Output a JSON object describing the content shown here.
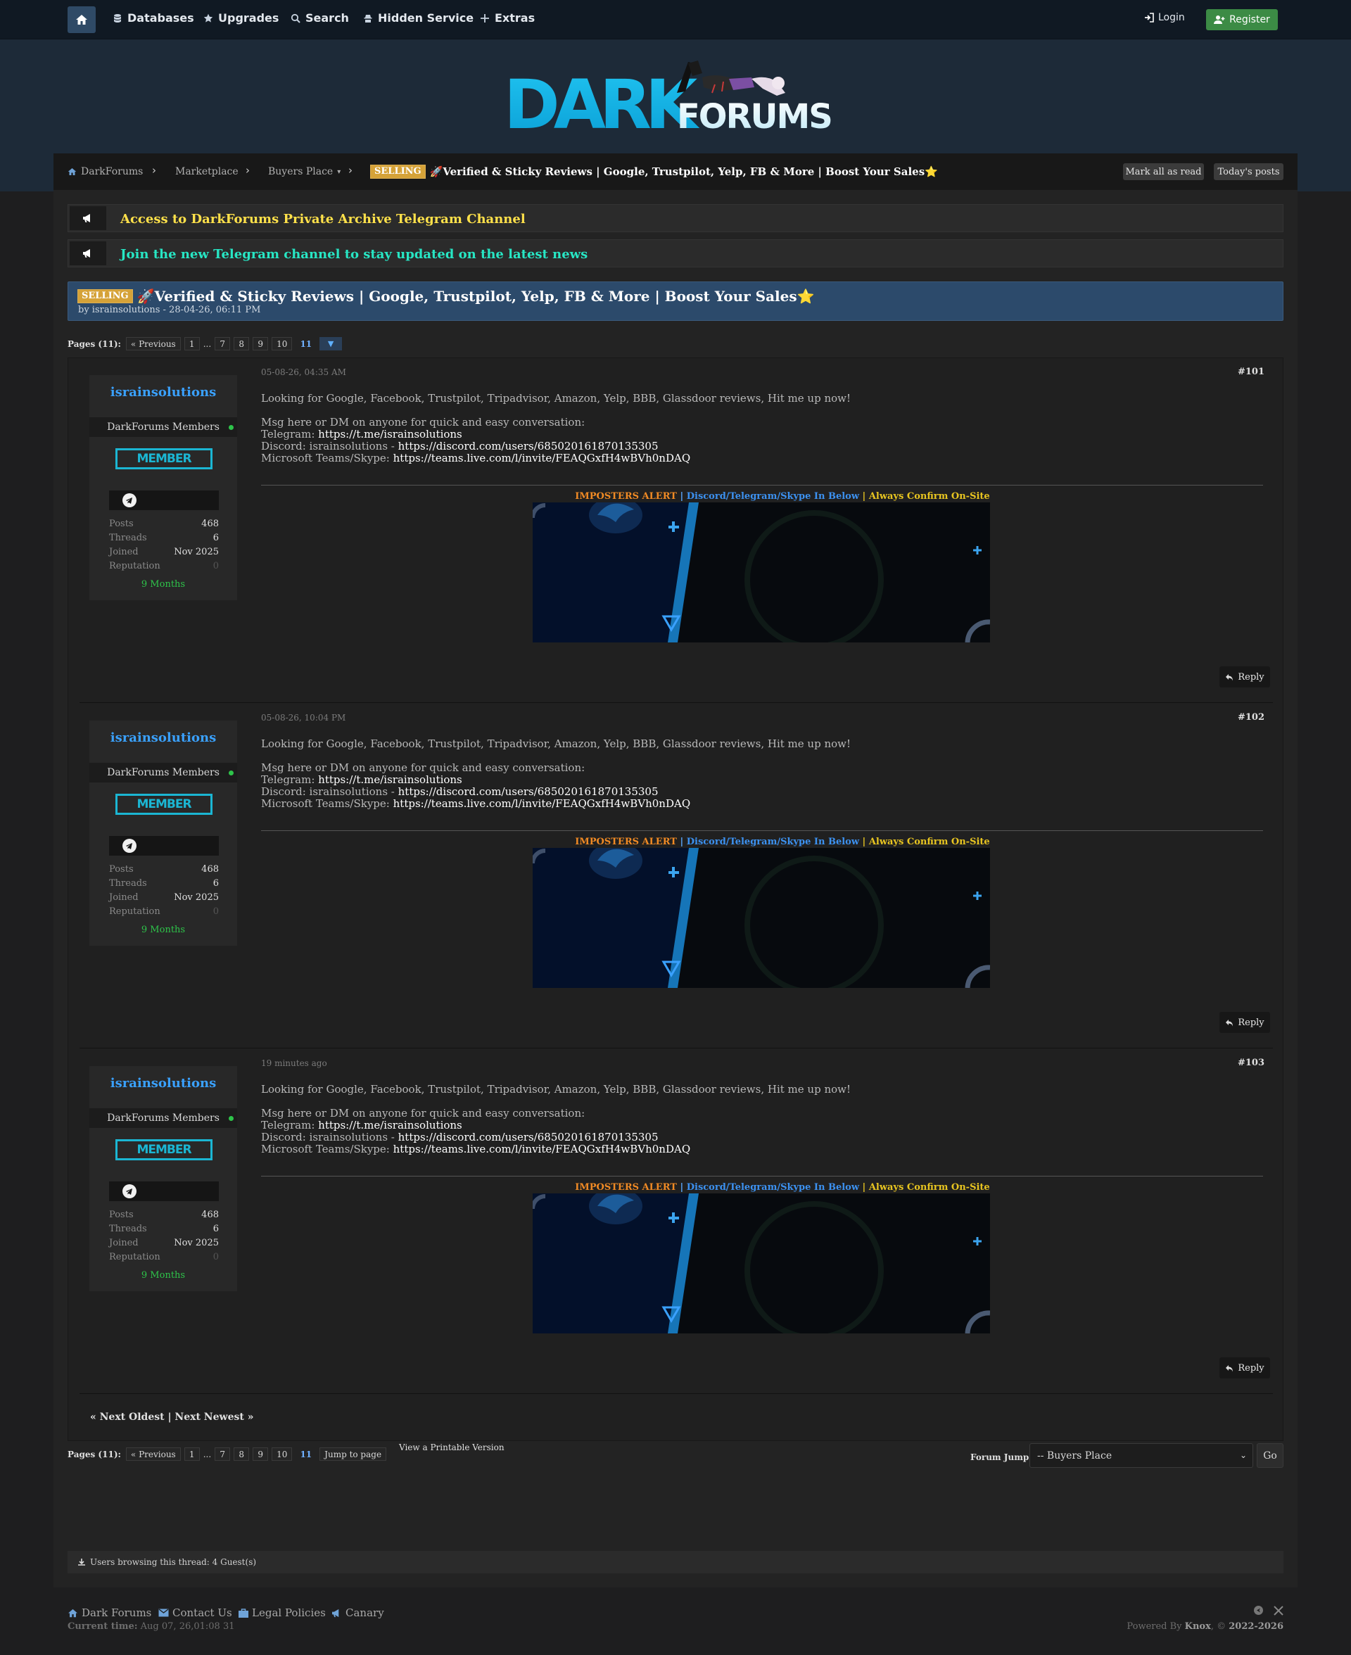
{
  "nav": {
    "items": [
      "Databases",
      "Upgrades",
      "Search",
      "Hidden Service",
      "Extras"
    ],
    "login": "Login",
    "register": "Register"
  },
  "logo": {
    "dark": "DARK",
    "forums": "FORUMS"
  },
  "breadcrumb": {
    "items": [
      "DarkForums",
      "Marketplace",
      "Buyers Place"
    ],
    "prefix": "SELLING",
    "current": "🚀Verified & Sticky Reviews | Google, Trustpilot, Yelp, FB & More | Boost Your Sales⭐"
  },
  "toolbar": {
    "mark_read": "Mark all as read",
    "todays_posts": "Today's posts"
  },
  "announcements": [
    {
      "text": "Access to DarkForums Private Archive Telegram Channel",
      "color": "#ffe14a"
    },
    {
      "text": "Join the new Telegram channel to stay updated on the latest news",
      "color": "#27e6c4"
    }
  ],
  "thread": {
    "prefix": "SELLING",
    "title": "🚀Verified & Sticky Reviews | Google, Trustpilot, Yelp, FB & More | Boost Your Sales⭐",
    "byline": "by israinsolutions - 28-04-26, 06:11 PM"
  },
  "pagination": {
    "label": "Pages (11):",
    "prev": "« Previous",
    "pages": [
      "1",
      "...",
      "7",
      "8",
      "9",
      "10",
      "11"
    ],
    "current": "11",
    "jump": "Jump to page"
  },
  "posts": [
    {
      "author": "israinsolutions",
      "group": "DarkForums Members",
      "rank": "MEMBER",
      "posts": "468",
      "threads": "6",
      "joined": "Nov 2025",
      "reputation": "0",
      "tenure": "9 Months",
      "date": "05-08-26, 04:35 AM",
      "number": "#101"
    },
    {
      "author": "israinsolutions",
      "group": "DarkForums Members",
      "rank": "MEMBER",
      "posts": "468",
      "threads": "6",
      "joined": "Nov 2025",
      "reputation": "0",
      "tenure": "9 Months",
      "date": "05-08-26, 10:04 PM",
      "number": "#102"
    },
    {
      "author": "israinsolutions",
      "group": "DarkForums Members",
      "rank": "MEMBER",
      "posts": "468",
      "threads": "6",
      "joined": "Nov 2025",
      "reputation": "0",
      "tenure": "9 Months",
      "date": "19 minutes ago",
      "number": "#103"
    }
  ],
  "stat_labels": {
    "posts": "Posts",
    "threads": "Threads",
    "joined": "Joined",
    "reputation": "Reputation"
  },
  "post_body": {
    "line1": "Looking for Google, Facebook, Trustpilot, Tripadvisor, Amazon, Yelp, BBB, Glassdoor reviews, Hit me up now!",
    "line2": "Msg here or DM on anyone for quick and easy conversation:",
    "tg_label": "Telegram: ",
    "tg_link": "https://t.me/israinsolutions",
    "dc_label": "Discord: israinsolutions - ",
    "dc_link": "https://discord.com/users/685020161870135305",
    "ms_label": "Microsoft Teams/Skype: ",
    "ms_link": "https://teams.live.com/l/invite/FEAQGxfH4wBVh0nDAQ",
    "alert_a": "IMPOSTERS ALERT",
    "alert_b": "Discord/Telegram/Skype In Below",
    "alert_c": "Always Confirm On-Site",
    "sep": " | "
  },
  "reply_label": "Reply",
  "next_links": "« Next Oldest | Next Newest »",
  "print_version": "View a Printable Version",
  "forum_jump": {
    "label": "Forum Jump:",
    "selected": "-- Buyers Place",
    "go": "Go"
  },
  "browsing": "Users browsing this thread: 4 Guest(s)",
  "footer": {
    "links": [
      "Dark Forums",
      "Contact Us",
      "Legal Policies",
      "Canary"
    ],
    "time_label": "Current time:",
    "time_value": "Aug 07, 26,01:08 31",
    "powered_pre": "Powered By ",
    "powered_name": "Knox",
    "powered_mid": ", © ",
    "powered_years": "2022-2026"
  },
  "colors": {
    "accent_blue": "#3aa1ff",
    "selling": "#d5a238",
    "online": "#2ec44a",
    "member": "#1bb6d3",
    "register": "#3c8b45"
  }
}
